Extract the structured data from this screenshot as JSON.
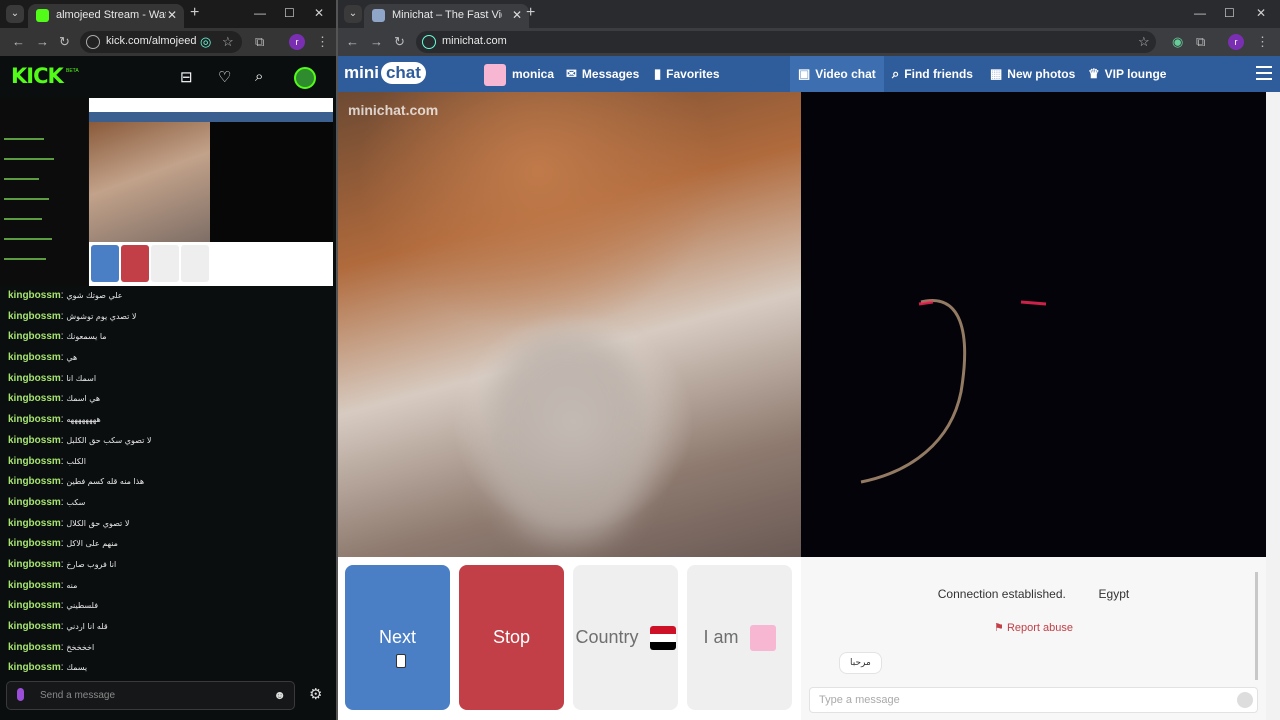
{
  "left_window": {
    "tab_title": "almojeed Stream - Watch Live o",
    "url": "kick.com/almojeed",
    "profile_letter": "r",
    "kick_logo": "KICK",
    "kick_beta": "BETA",
    "chat_messages": [
      {
        "user": "kingbossm",
        "text": "علي صوتك شوي"
      },
      {
        "user": "kingbossm",
        "text": "لا تصدي يوم توشوش"
      },
      {
        "user": "kingbossm",
        "text": "ما يسمعونك"
      },
      {
        "user": "kingbossm",
        "text": "هي"
      },
      {
        "user": "kingbossm",
        "text": "اسمك انا"
      },
      {
        "user": "kingbossm",
        "text": "هي اسمك"
      },
      {
        "user": "kingbossm",
        "text": "ههههههههه"
      },
      {
        "user": "kingbossm",
        "text": "لا تصوي سكب حق الكلبل"
      },
      {
        "user": "kingbossm",
        "text": "الكلب"
      },
      {
        "user": "kingbossm",
        "text": "هذا منه قله كسم فطين"
      },
      {
        "user": "kingbossm",
        "text": "سكب"
      },
      {
        "user": "kingbossm",
        "text": "لا تصوي حق الكلال"
      },
      {
        "user": "kingbossm",
        "text": "منهم على الاكل"
      },
      {
        "user": "kingbossm",
        "text": "انا فروب صارخ"
      },
      {
        "user": "kingbossm",
        "text": "منه"
      },
      {
        "user": "kingbossm",
        "text": "فلسطيني"
      },
      {
        "user": "kingbossm",
        "text": "قله انا اردني"
      },
      {
        "user": "kingbossm",
        "text": "اخخخخخ"
      },
      {
        "user": "kingbossm",
        "text": "يسمك"
      }
    ],
    "send_placeholder": "Send a message"
  },
  "right_window": {
    "tab_title": "Minichat – The Fast Video C",
    "url": "minichat.com",
    "profile_letter": "r",
    "logo_mini": "mini",
    "logo_chat": "chat",
    "watermark": "minichat.com",
    "nav": {
      "user": "monica",
      "messages": "Messages",
      "favorites": "Favorites",
      "video_chat": "Video chat",
      "find_friends": "Find friends",
      "new_photos": "New photos",
      "vip_lounge": "VIP lounge"
    },
    "controls": {
      "next": "Next",
      "stop": "Stop",
      "country": "Country",
      "iam": "I am"
    },
    "status": "Connection established.",
    "country_name": "Egypt",
    "report_abuse": "Report abuse",
    "incoming_message": "مرحبا",
    "message_placeholder": "Type a message"
  },
  "colors": {
    "kick_green": "#53fc18",
    "minichat_blue": "#2f5c9a",
    "next_blue": "#4a7fc6",
    "stop_red": "#c23f47"
  }
}
